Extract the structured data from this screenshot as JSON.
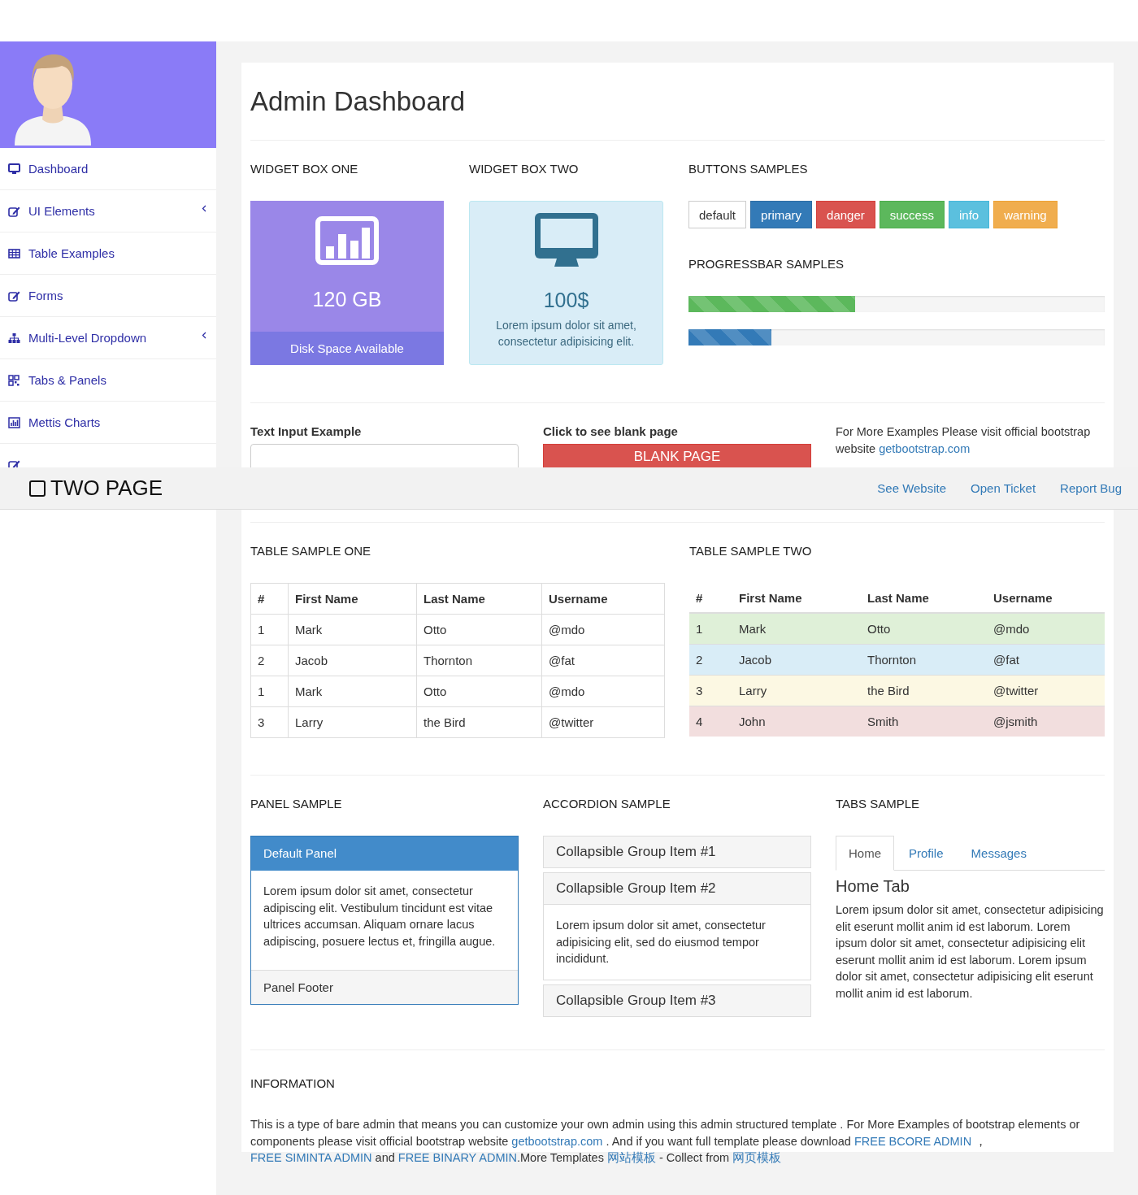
{
  "sidebar": {
    "items": [
      {
        "label": "Dashboard",
        "has_submenu": false
      },
      {
        "label": "UI Elements",
        "has_submenu": true
      },
      {
        "label": "Table Examples",
        "has_submenu": false
      },
      {
        "label": "Forms",
        "has_submenu": false
      },
      {
        "label": "Multi-Level Dropdown",
        "has_submenu": true
      },
      {
        "label": "Tabs & Panels",
        "has_submenu": false
      },
      {
        "label": "Mettis Charts",
        "has_submenu": false
      },
      {
        "has_submenu": false
      }
    ]
  },
  "top_bar": {
    "title": "TWO PAGE",
    "links": [
      "See Website",
      "Open Ticket",
      "Report Bug"
    ]
  },
  "page_title": "Admin Dashboard",
  "widget_one": {
    "heading": "WIDGET BOX ONE",
    "value": "120 GB",
    "footer": "Disk Space Available"
  },
  "widget_two": {
    "heading": "WIDGET BOX TWO",
    "value": "100$",
    "text": "Lorem ipsum dolor sit amet, consectetur adipisicing elit."
  },
  "buttons": {
    "heading": "BUTTONS SAMPLES",
    "items": [
      {
        "label": "default",
        "kind": "default"
      },
      {
        "label": "primary",
        "kind": "primary"
      },
      {
        "label": "danger",
        "kind": "danger"
      },
      {
        "label": "success",
        "kind": "success"
      },
      {
        "label": "info",
        "kind": "info"
      },
      {
        "label": "warning",
        "kind": "warning"
      }
    ]
  },
  "progress": {
    "heading": "PROGRESSBAR SAMPLES",
    "bars": [
      {
        "level": 0.4,
        "color": "#5cb85c"
      },
      {
        "level": 0.2,
        "color": "#337ab7"
      }
    ]
  },
  "form": {
    "input_label": "Text Input Example",
    "blank_label": "Click to see blank page",
    "blank_button": "BLANK PAGE",
    "note": [
      {
        "kind": "text",
        "text": "For More Examples Please visit official bootstrap website "
      },
      {
        "kind": "link",
        "text": "getbootstrap.com"
      }
    ]
  },
  "table_one": {
    "heading": "TABLE SAMPLE ONE",
    "columns": [
      "#",
      "First Name",
      "Last Name",
      "Username"
    ],
    "rows": [
      [
        "1",
        "Mark",
        "Otto",
        "@mdo"
      ],
      [
        "2",
        "Jacob",
        "Thornton",
        "@fat"
      ],
      [
        "1",
        "Mark",
        "Otto",
        "@mdo"
      ],
      [
        "3",
        "Larry",
        "the Bird",
        "@twitter"
      ]
    ]
  },
  "table_two": {
    "heading": "TABLE SAMPLE TWO",
    "columns": [
      "#",
      "First Name",
      "Last Name",
      "Username"
    ],
    "rows": [
      {
        "kind": "success",
        "cells": [
          "1",
          "Mark",
          "Otto",
          "@mdo"
        ]
      },
      {
        "kind": "info",
        "cells": [
          "2",
          "Jacob",
          "Thornton",
          "@fat"
        ]
      },
      {
        "kind": "warning",
        "cells": [
          "3",
          "Larry",
          "the Bird",
          "@twitter"
        ]
      },
      {
        "kind": "danger",
        "cells": [
          "4",
          "John",
          "Smith",
          "@jsmith"
        ]
      }
    ]
  },
  "panel": {
    "heading": "PANEL SAMPLE",
    "title": "Default Panel",
    "body": "Lorem ipsum dolor sit amet, consectetur adipiscing elit. Vestibulum tincidunt est vitae ultrices accumsan. Aliquam ornare lacus adipiscing, posuere lectus et, fringilla augue.",
    "footer": "Panel Footer"
  },
  "accordion": {
    "heading": "ACCORDION SAMPLE",
    "items": [
      {
        "title": "Collapsible Group Item #1",
        "expanded": false
      },
      {
        "title": "Collapsible Group Item #2",
        "expanded": true,
        "body": "Lorem ipsum dolor sit amet, consectetur adipisicing elit, sed do eiusmod tempor incididunt."
      },
      {
        "title": "Collapsible Group Item #3",
        "expanded": false
      }
    ]
  },
  "tabs": {
    "heading": "TABS SAMPLE",
    "items": [
      {
        "label": "Home",
        "selected": true
      },
      {
        "label": "Profile",
        "selected": false
      },
      {
        "label": "Messages",
        "selected": false
      }
    ],
    "pane_title": "Home Tab",
    "pane_text": "Lorem ipsum dolor sit amet, consectetur adipisicing elit eserunt mollit anim id est laborum. Lorem ipsum dolor sit amet, consectetur adipisicing elit eserunt mollit anim id est laborum. Lorem ipsum dolor sit amet, consectetur adipisicing elit eserunt mollit anim id est laborum."
  },
  "information": {
    "heading": "INFORMATION",
    "segments": [
      {
        "kind": "text",
        "text": "This is a type of bare admin that means you can customize your own admin using this admin structured template . For More Examples of bootstrap elements or components please visit official bootstrap website "
      },
      {
        "kind": "link",
        "text": "getbootstrap.com"
      },
      {
        "kind": "text",
        "text": " . And if you want full template please download "
      },
      {
        "kind": "link",
        "text": "FREE BCORE ADMIN"
      },
      {
        "kind": "text",
        "text": " ， "
      },
      {
        "kind": "link",
        "text": "FREE SIMINTA ADMIN"
      },
      {
        "kind": "text",
        "text": " and "
      },
      {
        "kind": "link",
        "text": "FREE BINARY ADMIN"
      },
      {
        "kind": "text",
        "text": ".More Templates "
      },
      {
        "kind": "link",
        "text": "网站模板"
      },
      {
        "kind": "text",
        "text": " - Collect from "
      },
      {
        "kind": "link",
        "text": "网页模板"
      }
    ]
  }
}
